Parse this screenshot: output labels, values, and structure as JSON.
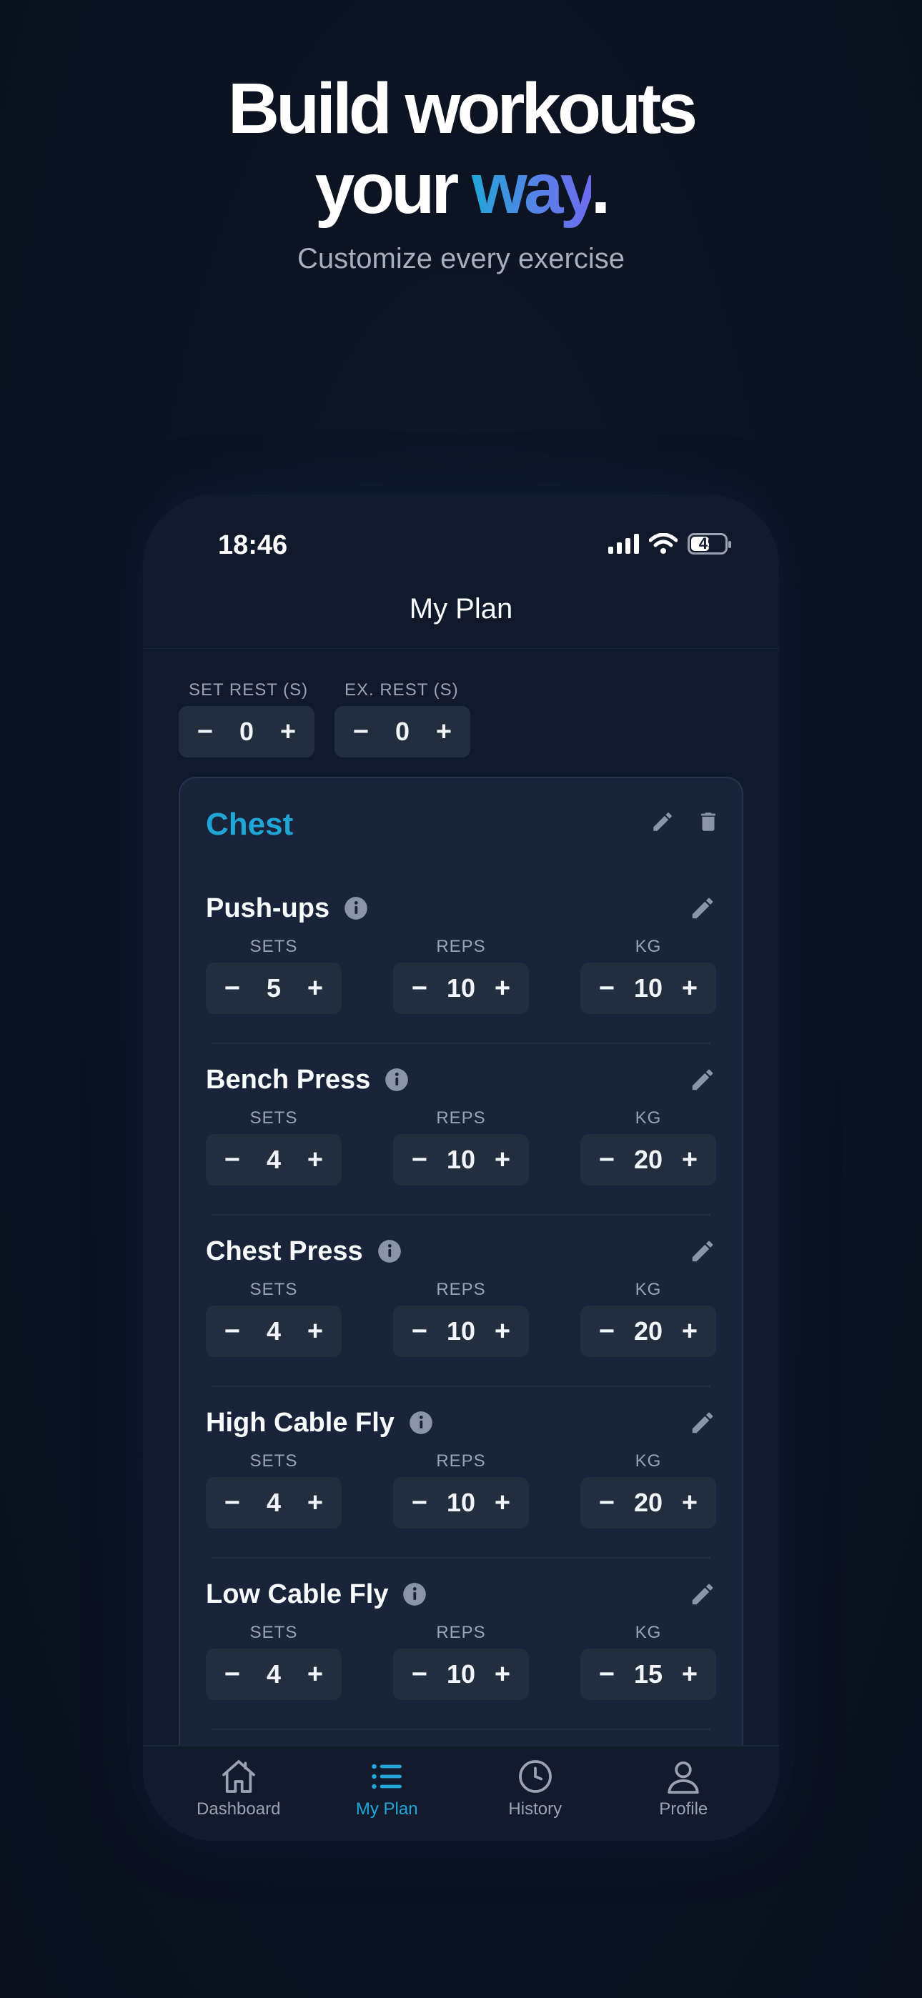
{
  "hero": {
    "line1": "Build workouts",
    "line2_prefix": "your ",
    "line2_accent": "way",
    "line2_suffix": ".",
    "subtitle": "Customize every exercise"
  },
  "status": {
    "time": "18:46",
    "battery": "49"
  },
  "nav": {
    "title": "My Plan"
  },
  "rest": [
    {
      "label": "SET REST (S)",
      "value": "0"
    },
    {
      "label": "EX. REST (S)",
      "value": "0"
    }
  ],
  "group": {
    "title": "Chest",
    "exercises": [
      {
        "name": "Push-ups",
        "sets": "5",
        "reps": "10",
        "kg": "10"
      },
      {
        "name": "Bench Press",
        "sets": "4",
        "reps": "10",
        "kg": "20"
      },
      {
        "name": "Chest Press",
        "sets": "4",
        "reps": "10",
        "kg": "20"
      },
      {
        "name": "High Cable Fly",
        "sets": "4",
        "reps": "10",
        "kg": "20"
      },
      {
        "name": "Low Cable Fly",
        "sets": "4",
        "reps": "10",
        "kg": "15"
      }
    ]
  },
  "labels": {
    "sets": "SETS",
    "reps": "REPS",
    "kg": "KG",
    "minus": "−",
    "plus": "+"
  },
  "tabs": [
    {
      "label": "Dashboard",
      "icon": "home-icon"
    },
    {
      "label": "My Plan",
      "icon": "list-icon",
      "active": true
    },
    {
      "label": "History",
      "icon": "clock-icon"
    },
    {
      "label": "Profile",
      "icon": "person-icon"
    }
  ],
  "colors": {
    "accent": "#22a5d8",
    "background": "#0b1220",
    "card": "#19243a"
  }
}
